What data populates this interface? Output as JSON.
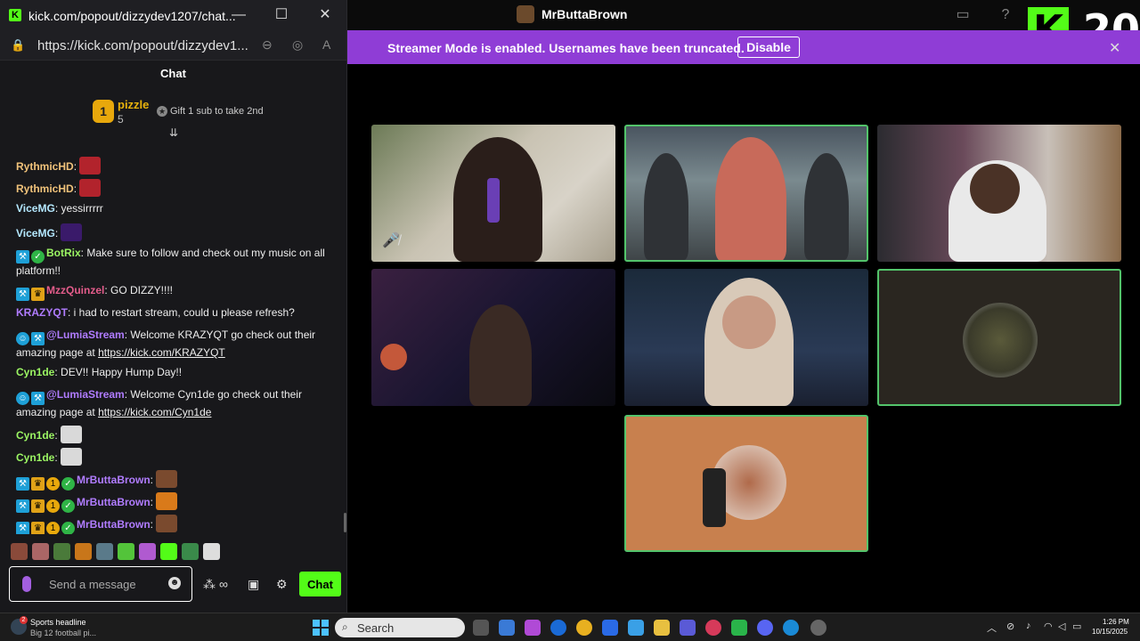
{
  "popout": {
    "window_title": "kick.com/popout/dizzydev1207/chat...",
    "url": "https://kick.com/popout/dizzydev1...",
    "chat_header": "Chat",
    "pinned": {
      "rank": "1",
      "name": "pizzle",
      "count": "5",
      "gift_text": "Gift 1 sub to take 2nd"
    },
    "messages": [
      {
        "user": "RythmicHD",
        "user_color": "#f0c27a",
        "text": "",
        "badges": [],
        "emote": "#b2232c"
      },
      {
        "user": "RythmicHD",
        "user_color": "#f0c27a",
        "text": "",
        "badges": [],
        "emote": "#b2232c"
      },
      {
        "user": "ViceMG",
        "user_color": "#b4e8ff",
        "text": "yessirrrrr",
        "badges": [],
        "emote": ""
      },
      {
        "user": "ViceMG",
        "user_color": "#b4e8ff",
        "text": "",
        "badges": [],
        "emote": "#3a1a6a"
      },
      {
        "user": "BotRix",
        "user_color": "#9bf563",
        "text": "Make sure to follow and check out my music on all platform!!",
        "badges": [
          "mod",
          "verified"
        ],
        "emote": ""
      },
      {
        "user": "MzzQuinzel",
        "user_color": "#e45c8b",
        "text": "GO DIZZY!!!!",
        "badges": [
          "mod",
          "vip"
        ],
        "emote": ""
      },
      {
        "user": "KRAZYQT",
        "user_color": "#b07cff",
        "text": "i had to restart stream, could u please refresh?",
        "badges": [],
        "emote": ""
      },
      {
        "user": "@LumiaStream",
        "user_color": "#b07cff",
        "text": "Welcome KRAZYQT go check out their amazing page at ",
        "link": "https://kick.com/KRAZYQT",
        "badges": [
          "bot",
          "mod"
        ],
        "emote": ""
      },
      {
        "user": "Cyn1de",
        "user_color": "#9bf563",
        "text": "DEV!! Happy Hump Day!!",
        "badges": [],
        "emote": ""
      },
      {
        "user": "@LumiaStream",
        "user_color": "#b07cff",
        "text": "Welcome Cyn1de go check out their amazing page at ",
        "link": "https://kick.com/Cyn1de",
        "badges": [
          "bot",
          "mod"
        ],
        "emote": ""
      },
      {
        "user": "Cyn1de",
        "user_color": "#9bf563",
        "text": "",
        "badges": [],
        "emote": "#d9d9d9"
      },
      {
        "user": "Cyn1de",
        "user_color": "#9bf563",
        "text": "",
        "badges": [],
        "emote": "#d9d9d9"
      },
      {
        "user": "MrButtaBrown",
        "user_color": "#b07cff",
        "text": "",
        "badges": [
          "mod",
          "vip",
          "sub",
          "verified"
        ],
        "emote": "#7a4a2e"
      },
      {
        "user": "MrButtaBrown",
        "user_color": "#b07cff",
        "text": "",
        "badges": [
          "mod",
          "vip",
          "sub",
          "verified"
        ],
        "emote": "#d97a1a"
      },
      {
        "user": "MrButtaBrown",
        "user_color": "#b07cff",
        "text": "",
        "badges": [
          "mod",
          "vip",
          "sub",
          "verified"
        ],
        "emote": "#7a4a2e"
      }
    ],
    "input_placeholder": "Send a message",
    "send_label": "Chat"
  },
  "app": {
    "title": "MrButtaBrown",
    "banner_text": "Streamer Mode is enabled. Usernames have been truncated.",
    "banner_button": "Disable",
    "logo_letter": "K",
    "logo_number": "20"
  },
  "taskbar": {
    "news_title": "Sports headline",
    "news_sub": "Big 12 football pi...",
    "news_badge": "2",
    "search_label": "Search",
    "time": "1:26 PM",
    "date": "10/15/2025"
  }
}
